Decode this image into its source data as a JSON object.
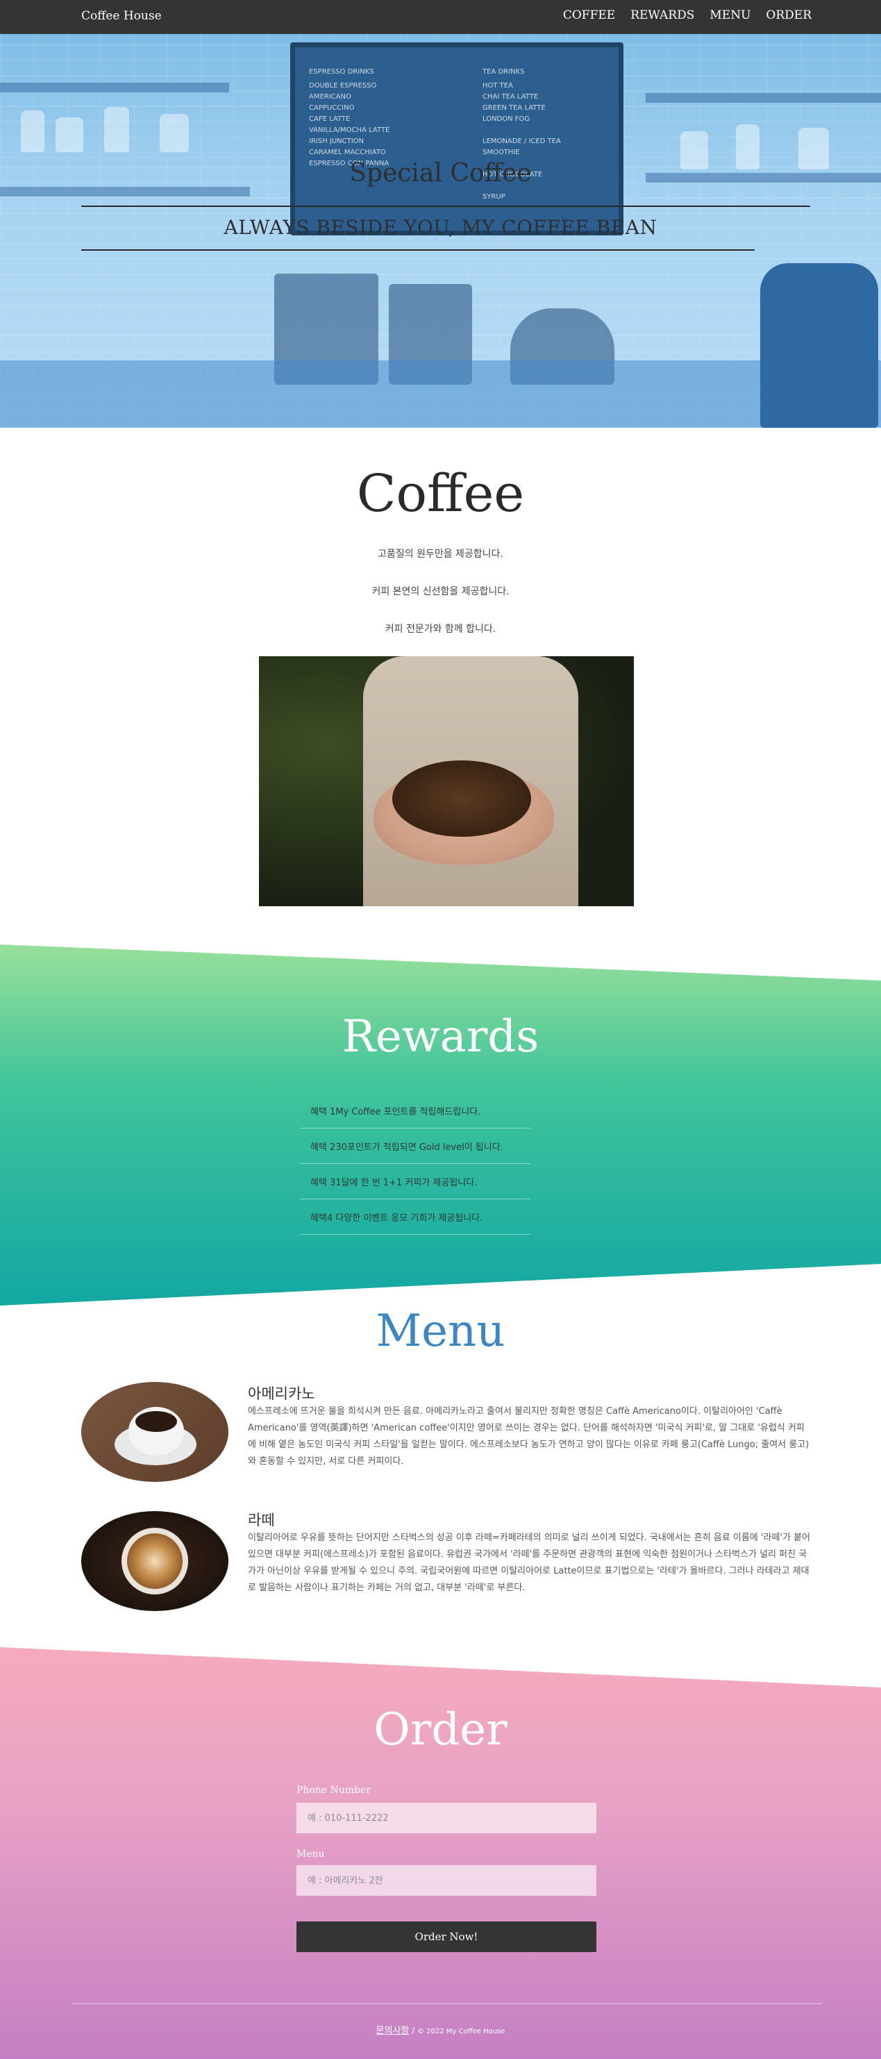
{
  "nav": {
    "brand": "Coffee House",
    "links": [
      "COFFEE",
      "REWARDS",
      "MENU",
      "ORDER"
    ]
  },
  "hero": {
    "title": "Special Coffee",
    "subtitle": "ALWAYS BESIDE YOU, MY COFFEE BEAN"
  },
  "coffee": {
    "title": "Coffee",
    "lines": [
      "고품질의 원두만을 제공합니다.",
      "커피 본연의 신선함을 제공합니다.",
      "커피 전문가와 함께 합니다."
    ]
  },
  "rewards": {
    "title": "Rewards",
    "items": [
      "혜택 1My Coffee 포인트를 적립해드립니다.",
      "혜택 230포인트가 적립되면 Gold level이 됩니다.",
      "혜택 31달에 한 번 1+1 커피가 제공됩니다.",
      "혜택4 다양한 이벤트 응모 기회가 제공됩니다."
    ]
  },
  "menu": {
    "title": "Menu",
    "items": [
      {
        "name": "아메리카노",
        "description": "에스프레소에 뜨거운 물을 희석시켜 만든 음료. 아메리카노라고 줄여서 불리지만 정확한 명칭은 Caffè Americano이다. 이탈리아어인 'Caffè Americano'를 영역(英譯)하면 'American coffee'이지만 영어로 쓰이는 경우는 없다. 단어를 해석하자면 '미국식 커피'로, 말 그대로 '유럽식 커피에 비해 옅은 농도인 미국식 커피 스타일'을 일컫는 말이다. 에스프레소보다 농도가 연하고 양이 많다는 이유로 카페 룽고(Caffè Lungo; 줄여서 룽고)와 혼동할 수 있지만, 서로 다른 커피이다."
      },
      {
        "name": "라떼",
        "description": "이탈리아어로 우유를 뜻하는 단어지만 스타벅스의 성공 이후 라떼=카페라테의 의미로 널리 쓰이게 되었다. 국내에서는 흔히 음료 이름에 '라떼'가 붙어 있으면 대부분 커피(에스프레소)가 포함된 음료이다. 유럽권 국가에서 '라떼'를 주문하면 관광객의 표현에 익숙한 점원이거나 스타벅스가 널리 퍼진 국가가 아닌이상 우유를 받게될 수 있으니 주의. 국립국어원에 따르면 이탈리아어로 Latte이므로 표기법으로는 '라테'가 올바르다. 그러나 라테라고 제대로 발음하는 사람이나 표기하는 카페는 거의 없고, 대부분 '라떼'로 부른다."
      }
    ]
  },
  "order": {
    "title": "Order",
    "phone_label": "Phone Number",
    "phone_placeholder": "예 : 010-111-2222",
    "menu_label": "Menu",
    "menu_placeholder": "예 : 아메리카노 2잔",
    "button": "Order Now!"
  },
  "footer": {
    "link": "문의사항",
    "separator": "/",
    "copyright": "© 2022 My Coffee House"
  },
  "colors": {
    "nav_bg": "#343434",
    "menu_title": "#3d86c6",
    "rewards_gradient": [
      "#98df9a",
      "#13a7a3"
    ],
    "order_gradient": [
      "#f6aabd",
      "#c47fc4"
    ]
  }
}
